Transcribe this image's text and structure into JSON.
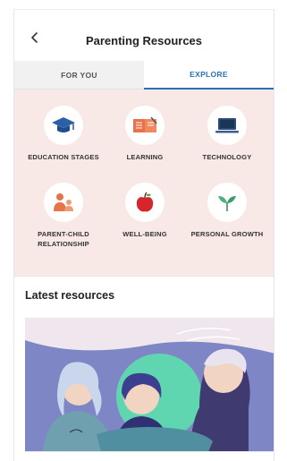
{
  "header": {
    "title": "Parenting Resources",
    "back_icon": "chevron-left-icon"
  },
  "tabs": [
    {
      "label": "FOR YOU",
      "active": false
    },
    {
      "label": "EXPLORE",
      "active": true
    }
  ],
  "categories": [
    {
      "label": "EDUCATION STAGES",
      "icon": "graduation-cap-icon"
    },
    {
      "label": "LEARNING",
      "icon": "book-icon"
    },
    {
      "label": "TECHNOLOGY",
      "icon": "laptop-icon"
    },
    {
      "label": "PARENT-CHILD RELATIONSHIP",
      "icon": "parent-child-icon"
    },
    {
      "label": "WELL-BEING",
      "icon": "apple-icon"
    },
    {
      "label": "PERSONAL GROWTH",
      "icon": "sprout-icon"
    }
  ],
  "latest": {
    "title": "Latest resources"
  },
  "colors": {
    "accent": "#2a6fb6",
    "category_bg": "#f8e9e6",
    "illustration_bg": "#7f86c6"
  }
}
